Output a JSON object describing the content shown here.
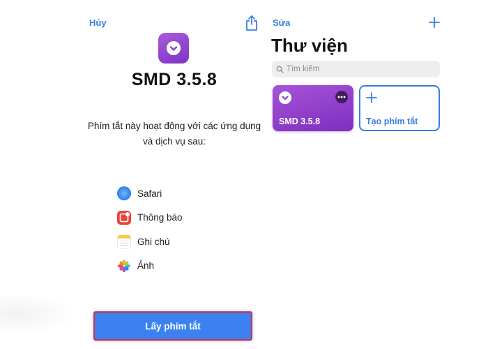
{
  "detail": {
    "cancel_label": "Hủy",
    "title": "SMD 3.5.8",
    "description": "Phím tắt này hoạt động với các ứng dụng và dịch vụ sau:",
    "apps": [
      {
        "name": "Safari",
        "icon": "safari-icon"
      },
      {
        "name": "Thông báo",
        "icon": "reminders-icon"
      },
      {
        "name": "Ghi chú",
        "icon": "notes-icon"
      },
      {
        "name": "Ảnh",
        "icon": "photos-icon"
      }
    ],
    "get_button_label": "Lấy phím tắt"
  },
  "library": {
    "edit_label": "Sửa",
    "title": "Thư viện",
    "search_placeholder": "Tìm kiếm",
    "cards": [
      {
        "name": "SMD 3.5.8",
        "color": "#8f3fcc"
      },
      {
        "name": "Tạo phím tắt",
        "color": "#3a7de0"
      }
    ]
  },
  "colors": {
    "accent": "#3a7de0",
    "shortcut_purple": "#8f3fcc",
    "button_blue": "#3b82f0",
    "highlight_border": "#c9304a"
  }
}
